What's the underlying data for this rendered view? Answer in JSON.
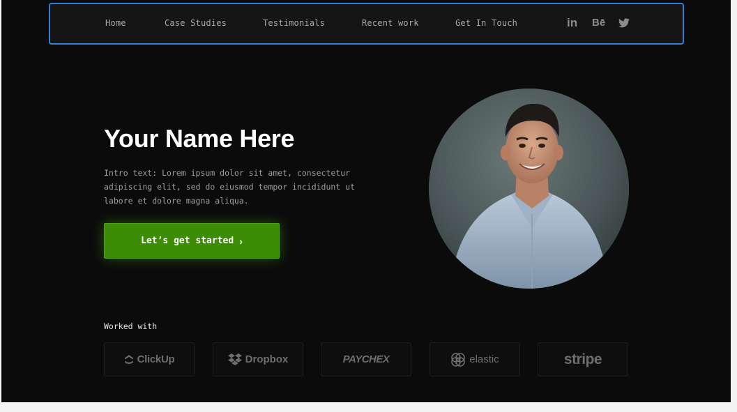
{
  "nav": {
    "links": [
      "Home",
      "Case Studies",
      "Testimonials",
      "Recent work",
      "Get In Touch"
    ],
    "social": [
      "linkedin-icon",
      "behance-icon",
      "twitter-icon"
    ],
    "social_text": {
      "linkedin": "in",
      "behance": "Bē"
    }
  },
  "hero": {
    "title": "Your Name Here",
    "intro": "Intro text: Lorem ipsum dolor sit amet, consectetur adipiscing elit, sed do eiusmod tempor incididunt ut labore et dolore magna aliqua.",
    "cta_label": "Let’s get started",
    "cta_chevron": "›"
  },
  "clients": {
    "heading": "Worked with",
    "logos": [
      "ClickUp",
      "Dropbox",
      "PAYCHEX",
      "elastic",
      "stripe"
    ]
  },
  "colors": {
    "accent": "#3c8c06",
    "background": "#0b0b0b",
    "nav_border": "#2f7fd6"
  }
}
